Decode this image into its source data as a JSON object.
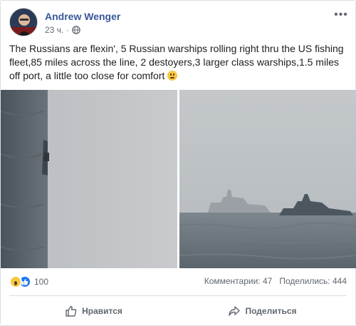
{
  "post": {
    "author": "Andrew Wenger",
    "time": "23 ч.",
    "separator": "·",
    "text": "The Russians are flexin', 5 Russian warships rolling right thru the US fishing fleet,85 miles across the line, 2 destoyers,3 larger class warships,1.5 miles off port, a little too close for comfort"
  },
  "reactions": {
    "count": "100"
  },
  "stats": {
    "comments": "Комментарии: 47",
    "shares": "Поделились: 444"
  },
  "actions": {
    "like": "Нравится",
    "share": "Поделиться"
  },
  "colors": {
    "link": "#385898",
    "secondary_text": "#606770",
    "like_blue": "#1877f2"
  }
}
